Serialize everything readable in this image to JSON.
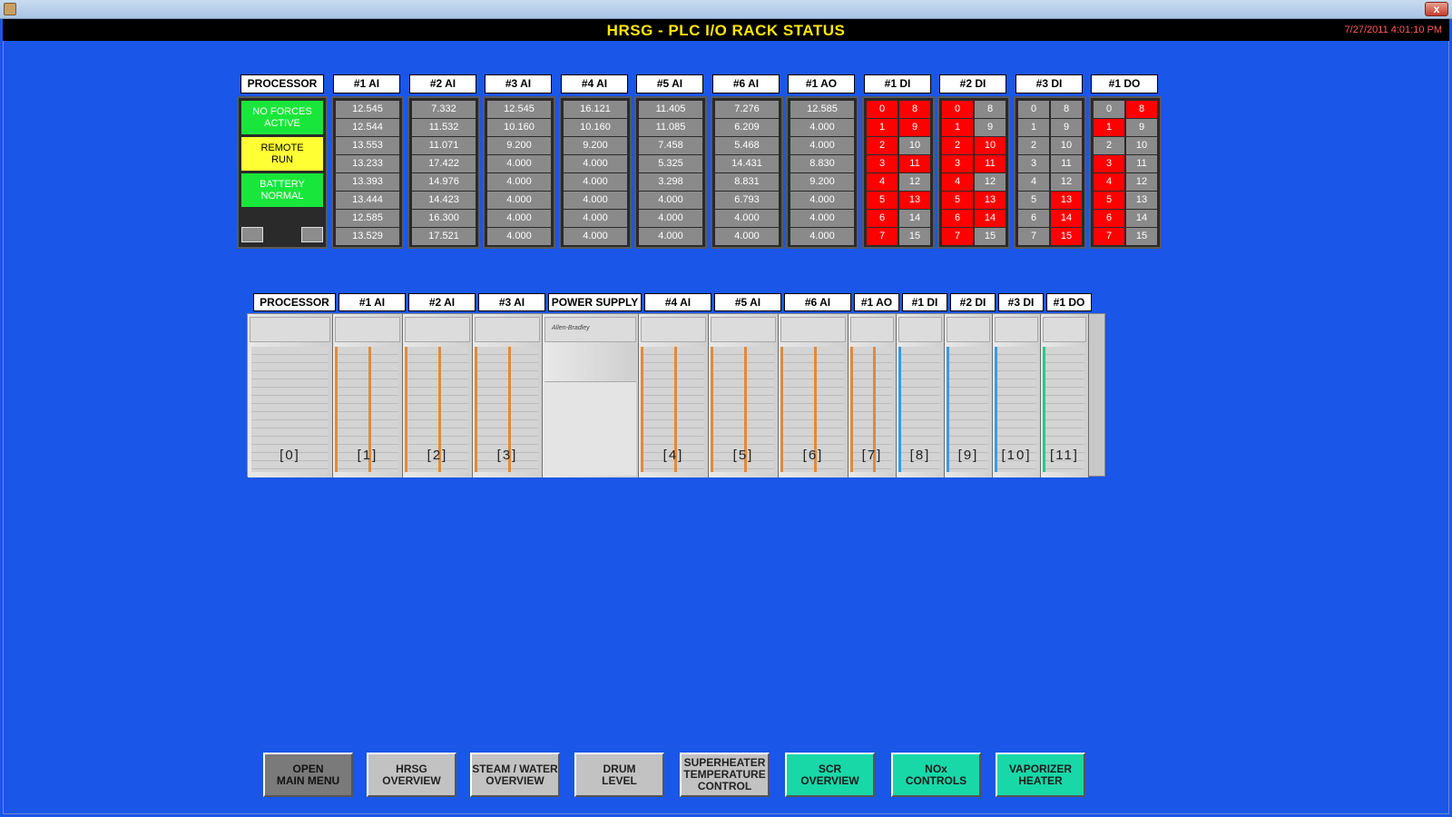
{
  "window": {
    "close_label": "x"
  },
  "header": {
    "title": "HRSG - PLC I/O RACK STATUS",
    "datetime": "7/27/2011 4:01:10 PM"
  },
  "status_grid": {
    "processor": {
      "label": "PROCESSOR",
      "statuses": [
        {
          "text": "NO FORCES\nACTIVE",
          "color": "#19e63a"
        },
        {
          "text": "REMOTE\nRUN",
          "color": "#ffff33"
        },
        {
          "text": "BATTERY\nNORMAL",
          "color": "#19e63a"
        }
      ]
    },
    "analog_modules": [
      {
        "label": "#1 AI",
        "values": [
          "12.545",
          "12.544",
          "13.553",
          "13.233",
          "13.393",
          "13.444",
          "12.585",
          "13.529"
        ]
      },
      {
        "label": "#2 AI",
        "values": [
          "7.332",
          "11.532",
          "11.071",
          "17.422",
          "14.976",
          "14.423",
          "16.300",
          "17.521"
        ]
      },
      {
        "label": "#3 AI",
        "values": [
          "12.545",
          "10.160",
          "9.200",
          "4.000",
          "4.000",
          "4.000",
          "4.000",
          "4.000"
        ]
      },
      {
        "label": "#4 AI",
        "values": [
          "16.121",
          "10.160",
          "9.200",
          "4.000",
          "4.000",
          "4.000",
          "4.000",
          "4.000"
        ]
      },
      {
        "label": "#5 AI",
        "values": [
          "11.405",
          "11.085",
          "7.458",
          "5.325",
          "3.298",
          "4.000",
          "4.000",
          "4.000"
        ]
      },
      {
        "label": "#6 AI",
        "values": [
          "7.276",
          "6.209",
          "5.468",
          "14.431",
          "8.831",
          "6.793",
          "4.000",
          "4.000"
        ]
      },
      {
        "label": "#1 AO",
        "values": [
          "12.585",
          "4.000",
          "4.000",
          "8.830",
          "9.200",
          "4.000",
          "4.000",
          "4.000"
        ]
      }
    ],
    "discrete_modules": [
      {
        "label": "#1 DI",
        "left": [
          {
            "n": "0",
            "on": true
          },
          {
            "n": "1",
            "on": true
          },
          {
            "n": "2",
            "on": true
          },
          {
            "n": "3",
            "on": true
          },
          {
            "n": "4",
            "on": true
          },
          {
            "n": "5",
            "on": true
          },
          {
            "n": "6",
            "on": true
          },
          {
            "n": "7",
            "on": true
          }
        ],
        "right": [
          {
            "n": "8",
            "on": true
          },
          {
            "n": "9",
            "on": true
          },
          {
            "n": "10",
            "on": false
          },
          {
            "n": "11",
            "on": true
          },
          {
            "n": "12",
            "on": false
          },
          {
            "n": "13",
            "on": true
          },
          {
            "n": "14",
            "on": false
          },
          {
            "n": "15",
            "on": false
          }
        ]
      },
      {
        "label": "#2 DI",
        "left": [
          {
            "n": "0",
            "on": true
          },
          {
            "n": "1",
            "on": true
          },
          {
            "n": "2",
            "on": true
          },
          {
            "n": "3",
            "on": true
          },
          {
            "n": "4",
            "on": true
          },
          {
            "n": "5",
            "on": true
          },
          {
            "n": "6",
            "on": true
          },
          {
            "n": "7",
            "on": true
          }
        ],
        "right": [
          {
            "n": "8",
            "on": false
          },
          {
            "n": "9",
            "on": false
          },
          {
            "n": "10",
            "on": true
          },
          {
            "n": "11",
            "on": true
          },
          {
            "n": "12",
            "on": false
          },
          {
            "n": "13",
            "on": true
          },
          {
            "n": "14",
            "on": true
          },
          {
            "n": "15",
            "on": false
          }
        ]
      },
      {
        "label": "#3 DI",
        "left": [
          {
            "n": "0",
            "on": false
          },
          {
            "n": "1",
            "on": false
          },
          {
            "n": "2",
            "on": false
          },
          {
            "n": "3",
            "on": false
          },
          {
            "n": "4",
            "on": false
          },
          {
            "n": "5",
            "on": false
          },
          {
            "n": "6",
            "on": false
          },
          {
            "n": "7",
            "on": false
          }
        ],
        "right": [
          {
            "n": "8",
            "on": false
          },
          {
            "n": "9",
            "on": false
          },
          {
            "n": "10",
            "on": false
          },
          {
            "n": "11",
            "on": false
          },
          {
            "n": "12",
            "on": false
          },
          {
            "n": "13",
            "on": true
          },
          {
            "n": "14",
            "on": true
          },
          {
            "n": "15",
            "on": true
          }
        ]
      },
      {
        "label": "#1 DO",
        "left": [
          {
            "n": "0",
            "on": false
          },
          {
            "n": "1",
            "on": true
          },
          {
            "n": "2",
            "on": false
          },
          {
            "n": "3",
            "on": true
          },
          {
            "n": "4",
            "on": true
          },
          {
            "n": "5",
            "on": true
          },
          {
            "n": "6",
            "on": true
          },
          {
            "n": "7",
            "on": true
          }
        ],
        "right": [
          {
            "n": "8",
            "on": true
          },
          {
            "n": "9",
            "on": false
          },
          {
            "n": "10",
            "on": false
          },
          {
            "n": "11",
            "on": false
          },
          {
            "n": "12",
            "on": false
          },
          {
            "n": "13",
            "on": false
          },
          {
            "n": "14",
            "on": false
          },
          {
            "n": "15",
            "on": false
          }
        ]
      }
    ]
  },
  "rack": {
    "labels": [
      "PROCESSOR",
      "#1 AI",
      "#2 AI",
      "#3 AI",
      "POWER SUPPLY",
      "#4 AI",
      "#5 AI",
      "#6 AI",
      "#1 AO",
      "#1 DI",
      "#2 DI",
      "#3 DI",
      "#1 DO"
    ],
    "slot_numbers": [
      "[0]",
      "[1]",
      "[2]",
      "[3]",
      "",
      "[4]",
      "[5]",
      "[6]",
      "[7]",
      "[8]",
      "[9]",
      "[10]",
      "[11]"
    ],
    "brand": "Allen-Bradley"
  },
  "nav": [
    {
      "label": "OPEN\nMAIN MENU",
      "style": "dark"
    },
    {
      "label": "HRSG\nOVERVIEW",
      "style": "gray"
    },
    {
      "label": "STEAM / WATER\nOVERVIEW",
      "style": "gray"
    },
    {
      "label": "DRUM\nLEVEL",
      "style": "gray"
    },
    {
      "label": "SUPERHEATER\nTEMPERATURE\nCONTROL",
      "style": "gray"
    },
    {
      "label": "SCR\nOVERVIEW",
      "style": "teal"
    },
    {
      "label": "NOx\nCONTROLS",
      "style": "teal"
    },
    {
      "label": "VAPORIZER\nHEATER",
      "style": "teal"
    }
  ]
}
